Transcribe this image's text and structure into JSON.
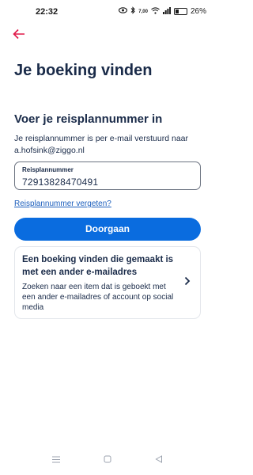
{
  "status_bar": {
    "time": "22:32",
    "icons": [
      "eye-icon",
      "bluetooth-icon",
      "data-speed-icon",
      "wifi-icon",
      "signal-icon",
      "battery-icon"
    ],
    "data_speed": "7,00",
    "battery": "26%"
  },
  "header": {
    "back_icon": "arrow-left-icon",
    "back_color": "#e01848",
    "title": "Je boeking vinden"
  },
  "form": {
    "heading": "Voer je reisplannummer in",
    "description": "Je reisplannummer is per e-mail verstuurd naar a.hofsink@ziggo.nl",
    "field_label": "Reisplannummer",
    "field_value": "72913828470491",
    "forgot_link": "Reisplannummer vergeten?",
    "submit_label": "Doorgaan",
    "button_color": "#0a6cdf"
  },
  "alt_card": {
    "title": "Een boeking vinden die gemaakt is met een ander e-mailadres",
    "description": "Zoeken naar een item dat is geboekt met een ander e-mailadres of account op social media",
    "chevron_icon": "chevron-right-icon"
  },
  "nav_bar": {
    "items": [
      "menu-icon",
      "home-icon",
      "back-icon"
    ]
  }
}
